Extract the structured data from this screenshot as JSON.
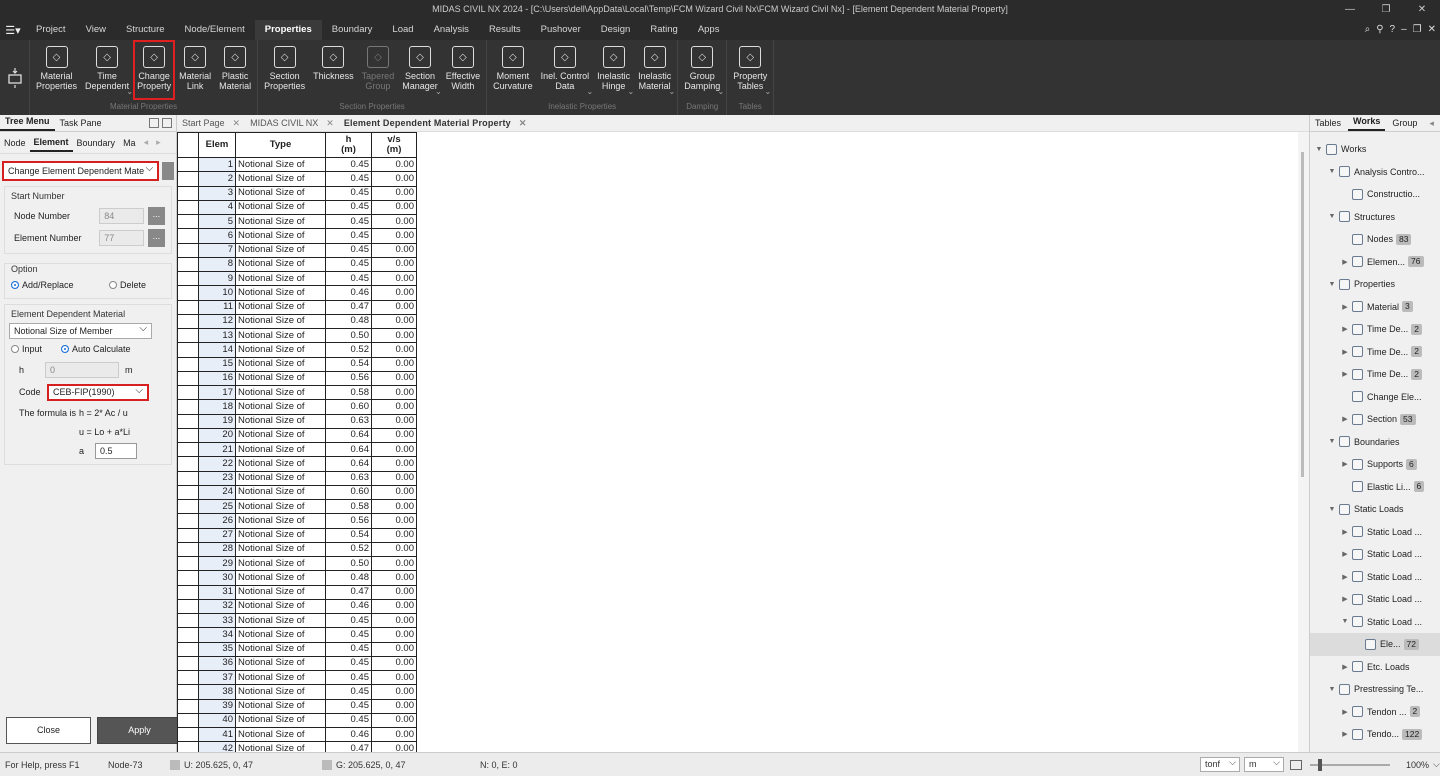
{
  "window": {
    "title": "MIDAS CIVIL NX 2024 - [C:\\Users\\dell\\AppData\\Local\\Temp\\FCM Wizard Civil Nx\\FCM Wizard Civil Nx] - [Element Dependent Material Property]"
  },
  "menu": [
    "Project",
    "View",
    "Structure",
    "Node/Element",
    "Properties",
    "Boundary",
    "Load",
    "Analysis",
    "Results",
    "Pushover",
    "Design",
    "Rating",
    "Apps"
  ],
  "menu_active": "Properties",
  "ribbon": {
    "groups": [
      {
        "label": "Material Properties",
        "buttons": [
          {
            "label": "Material\nProperties",
            "icon": "material-icon"
          },
          {
            "label": "Time\nDependent",
            "icon": "time-dependent-icon",
            "dropdown": true
          },
          {
            "label": "Change\nProperty",
            "icon": "change-property-icon",
            "highlighted": true
          },
          {
            "label": "Material\nLink",
            "icon": "link-icon"
          },
          {
            "label": "Plastic\nMaterial",
            "icon": "plastic-icon"
          }
        ]
      },
      {
        "label": "Section Properties",
        "buttons": [
          {
            "label": "Section\nProperties",
            "icon": "section-icon"
          },
          {
            "label": "Thickness",
            "icon": "thickness-icon"
          },
          {
            "label": "Tapered\nGroup",
            "icon": "tapered-icon",
            "disabled": true
          },
          {
            "label": "Section\nManager",
            "icon": "section-manager-icon",
            "dropdown": true
          },
          {
            "label": "Effective\nWidth",
            "icon": "effective-width-icon"
          }
        ]
      },
      {
        "label": "Inelastic Properties",
        "buttons": [
          {
            "label": "Moment\nCurvature",
            "icon": "moment-curvature-icon"
          },
          {
            "label": "Inel. Control\nData",
            "icon": "inel-control-icon",
            "dropdown": true
          },
          {
            "label": "Inelastic\nHinge",
            "icon": "hinge-icon",
            "dropdown": true
          },
          {
            "label": "Inelastic\nMaterial",
            "icon": "inelastic-material-icon",
            "dropdown": true
          }
        ]
      },
      {
        "label": "Damping",
        "buttons": [
          {
            "label": "Group\nDamping",
            "icon": "damping-icon",
            "dropdown": true
          }
        ]
      },
      {
        "label": "Tables",
        "buttons": [
          {
            "label": "Property\nTables",
            "icon": "tables-icon",
            "dropdown": true
          }
        ]
      }
    ]
  },
  "left": {
    "tabs": [
      "Tree Menu",
      "Task Pane"
    ],
    "subtabs": [
      "Node",
      "Element",
      "Boundary",
      "Ma"
    ],
    "function_select": "Change Element Dependent Mate",
    "start_number": {
      "title": "Start Number",
      "node_label": "Node Number",
      "node_value": "84",
      "elem_label": "Element Number",
      "elem_value": "77",
      "dots": "..."
    },
    "option": {
      "title": "Option",
      "add": "Add/Replace",
      "del": "Delete"
    },
    "edm": {
      "title": "Element Dependent Material",
      "type_select": "Notional Size of Member",
      "input": "Input",
      "auto": "Auto Calculate",
      "h_label": "h",
      "h_value": "0",
      "h_unit": "m",
      "code_label": "Code",
      "code_value": "CEB-FIP(1990)",
      "formula_label": "The formula is",
      "formula1": "h = 2* Ac / u",
      "formula2": "u = Lo + a*Li",
      "a_label": "a",
      "a_value": "0.5"
    },
    "close": "Close",
    "apply": "Apply"
  },
  "doctabs": [
    {
      "label": "Start Page",
      "active": false
    },
    {
      "label": "MIDAS CIVIL NX",
      "active": false
    },
    {
      "label": "Element Dependent Material Property",
      "active": true
    }
  ],
  "table": {
    "headers": [
      "Elem",
      "Type",
      "h\n(m)",
      "v/s\n(m)"
    ],
    "type_text": "Notional Size of",
    "rows": [
      [
        1,
        "0.45",
        "0.00"
      ],
      [
        2,
        "0.45",
        "0.00"
      ],
      [
        3,
        "0.45",
        "0.00"
      ],
      [
        4,
        "0.45",
        "0.00"
      ],
      [
        5,
        "0.45",
        "0.00"
      ],
      [
        6,
        "0.45",
        "0.00"
      ],
      [
        7,
        "0.45",
        "0.00"
      ],
      [
        8,
        "0.45",
        "0.00"
      ],
      [
        9,
        "0.45",
        "0.00"
      ],
      [
        10,
        "0.46",
        "0.00"
      ],
      [
        11,
        "0.47",
        "0.00"
      ],
      [
        12,
        "0.48",
        "0.00"
      ],
      [
        13,
        "0.50",
        "0.00"
      ],
      [
        14,
        "0.52",
        "0.00"
      ],
      [
        15,
        "0.54",
        "0.00"
      ],
      [
        16,
        "0.56",
        "0.00"
      ],
      [
        17,
        "0.58",
        "0.00"
      ],
      [
        18,
        "0.60",
        "0.00"
      ],
      [
        19,
        "0.63",
        "0.00"
      ],
      [
        20,
        "0.64",
        "0.00"
      ],
      [
        21,
        "0.64",
        "0.00"
      ],
      [
        22,
        "0.64",
        "0.00"
      ],
      [
        23,
        "0.63",
        "0.00"
      ],
      [
        24,
        "0.60",
        "0.00"
      ],
      [
        25,
        "0.58",
        "0.00"
      ],
      [
        26,
        "0.56",
        "0.00"
      ],
      [
        27,
        "0.54",
        "0.00"
      ],
      [
        28,
        "0.52",
        "0.00"
      ],
      [
        29,
        "0.50",
        "0.00"
      ],
      [
        30,
        "0.48",
        "0.00"
      ],
      [
        31,
        "0.47",
        "0.00"
      ],
      [
        32,
        "0.46",
        "0.00"
      ],
      [
        33,
        "0.45",
        "0.00"
      ],
      [
        34,
        "0.45",
        "0.00"
      ],
      [
        35,
        "0.45",
        "0.00"
      ],
      [
        36,
        "0.45",
        "0.00"
      ],
      [
        37,
        "0.45",
        "0.00"
      ],
      [
        38,
        "0.45",
        "0.00"
      ],
      [
        39,
        "0.45",
        "0.00"
      ],
      [
        40,
        "0.45",
        "0.00"
      ],
      [
        41,
        "0.46",
        "0.00"
      ],
      [
        42,
        "0.47",
        "0.00"
      ]
    ]
  },
  "right": {
    "tabs": [
      "Tables",
      "Works",
      "Group"
    ],
    "tree": [
      {
        "label": "Works",
        "level": 0,
        "arrow": "open"
      },
      {
        "label": "Analysis Contro...",
        "level": 1,
        "arrow": "open"
      },
      {
        "label": "Constructio...",
        "level": 2,
        "arrow": ""
      },
      {
        "label": "Structures",
        "level": 1,
        "arrow": "open"
      },
      {
        "label": "Nodes",
        "level": 2,
        "arrow": "",
        "badge": "83"
      },
      {
        "label": "Elemen...",
        "level": 2,
        "arrow": "closed",
        "badge": "76"
      },
      {
        "label": "Properties",
        "level": 1,
        "arrow": "open"
      },
      {
        "label": "Material",
        "level": 2,
        "arrow": "closed",
        "badge": "3"
      },
      {
        "label": "Time De...",
        "level": 2,
        "arrow": "closed",
        "badge": "2"
      },
      {
        "label": "Time De...",
        "level": 2,
        "arrow": "closed",
        "badge": "2"
      },
      {
        "label": "Time De...",
        "level": 2,
        "arrow": "closed",
        "badge": "2"
      },
      {
        "label": "Change Ele...",
        "level": 2,
        "arrow": ""
      },
      {
        "label": "Section",
        "level": 2,
        "arrow": "closed",
        "badge": "53"
      },
      {
        "label": "Boundaries",
        "level": 1,
        "arrow": "open"
      },
      {
        "label": "Supports",
        "level": 2,
        "arrow": "closed",
        "badge": "6"
      },
      {
        "label": "Elastic Li...",
        "level": 2,
        "arrow": "",
        "badge": "6"
      },
      {
        "label": "Static Loads",
        "level": 1,
        "arrow": "open"
      },
      {
        "label": "Static Load ...",
        "level": 2,
        "arrow": "closed"
      },
      {
        "label": "Static Load ...",
        "level": 2,
        "arrow": "closed"
      },
      {
        "label": "Static Load ...",
        "level": 2,
        "arrow": "closed"
      },
      {
        "label": "Static Load ...",
        "level": 2,
        "arrow": "closed"
      },
      {
        "label": "Static Load ...",
        "level": 2,
        "arrow": "open"
      },
      {
        "label": "Ele...",
        "level": 3,
        "arrow": "",
        "badge": "72",
        "selected": true
      },
      {
        "label": "Etc. Loads",
        "level": 2,
        "arrow": "closed"
      },
      {
        "label": "Prestressing Te...",
        "level": 1,
        "arrow": "open"
      },
      {
        "label": "Tendon ...",
        "level": 2,
        "arrow": "closed",
        "badge": "2"
      },
      {
        "label": "Tendo...",
        "level": 2,
        "arrow": "closed",
        "badge": "122"
      }
    ]
  },
  "status": {
    "help": "For Help, press F1",
    "node": "Node-73",
    "ucs": "U: 205.625, 0, 47",
    "gcs": "G: 205.625, 0, 47",
    "ne": "N: 0, E: 0",
    "force_unit": "tonf",
    "length_unit": "m",
    "zoom": "100%"
  }
}
